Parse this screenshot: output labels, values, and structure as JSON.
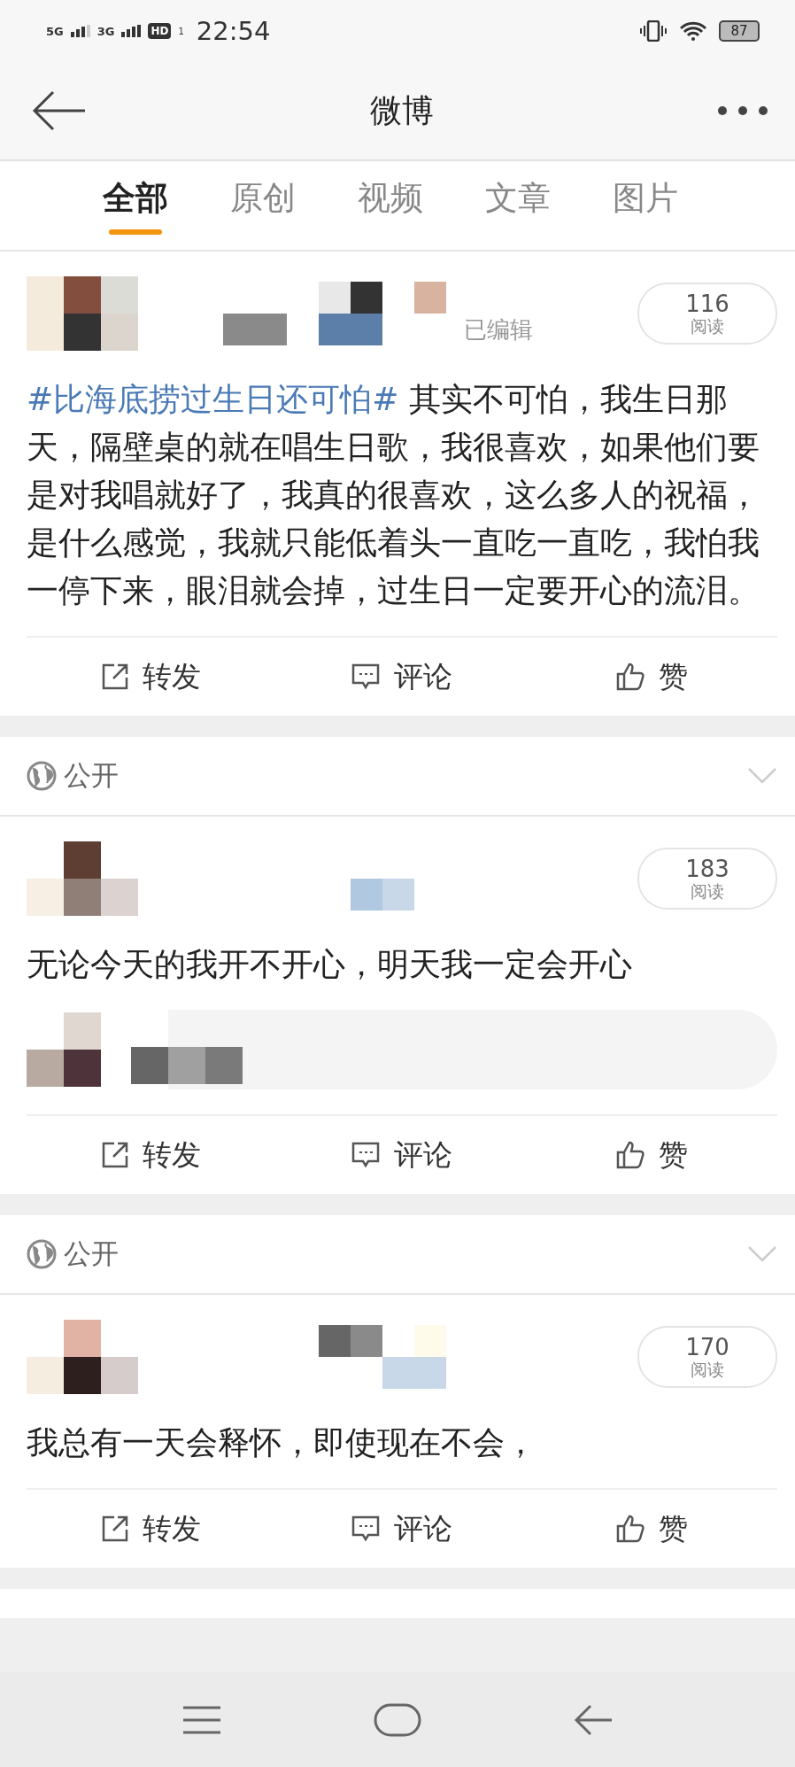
{
  "status_bar": {
    "network_1": "5G",
    "network_2": "3G",
    "hd": "HD",
    "hd_index": "1",
    "time": "22:54",
    "battery": "87"
  },
  "header": {
    "title": "微博"
  },
  "tabs": [
    {
      "label": "全部",
      "selected": true
    },
    {
      "label": "原创",
      "selected": false
    },
    {
      "label": "视频",
      "selected": false
    },
    {
      "label": "文章",
      "selected": false
    },
    {
      "label": "图片",
      "selected": false
    }
  ],
  "posts": [
    {
      "reads": "116",
      "reads_label": "阅读",
      "edited": "已编辑",
      "hashtag": "#比海底捞过生日还可怕#",
      "text": "其实不可怕，我生日那天，隔壁桌的就在唱生日歌，我很喜欢，如果他们要是对我唱就好了，我真的很喜欢，这么多人的祝福，是什么感觉，我就只能低着头一直吃一直吃，我怕我一停下来，眼泪就会掉，过生日一定要开心的流泪。",
      "actions": [
        "转发",
        "评论",
        "赞"
      ]
    },
    {
      "visibility": "公开",
      "reads": "183",
      "reads_label": "阅读",
      "text": "无论今天的我开不开心，明天我一定会开心",
      "comment_preview": true,
      "actions": [
        "转发",
        "评论",
        "赞"
      ]
    },
    {
      "visibility": "公开",
      "reads": "170",
      "reads_label": "阅读",
      "text": "我总有一天会释怀，即使现在不会，",
      "actions": [
        "转发",
        "评论",
        "赞"
      ]
    }
  ]
}
